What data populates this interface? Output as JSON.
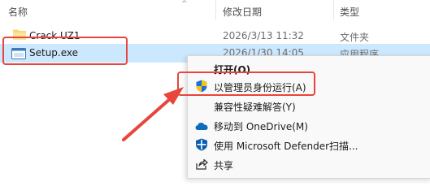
{
  "columns": {
    "name": "名称",
    "modified": "修改日期",
    "type": "类型"
  },
  "files": [
    {
      "name": "Crack UZ1",
      "modified": "2026/3/13 11:32",
      "type": "文件夹",
      "icon": "folder-icon"
    },
    {
      "name": "Setup.exe",
      "modified": "2026/1/30 14:05",
      "type": "应用程序",
      "icon": "exe-icon"
    }
  ],
  "context_menu": {
    "items": [
      {
        "label": "打开(O)",
        "icon": ""
      },
      {
        "label": "以管理员身份运行(A)",
        "icon": "uac-shield-icon"
      },
      {
        "label": "兼容性疑难解答(Y)",
        "icon": ""
      },
      {
        "label": "移动到 OneDrive(M)",
        "icon": "onedrive-icon"
      },
      {
        "label": "使用 Microsoft Defender扫描...",
        "icon": "defender-icon"
      },
      {
        "label": "共享",
        "icon": "share-icon"
      }
    ]
  },
  "colors": {
    "selection": "#cce8ff",
    "annotation": "#e8453c",
    "folder": "#f8d775",
    "uac_blue": "#1e6fd9",
    "uac_yellow": "#f3c318",
    "onedrive": "#0f6cbd",
    "defender": "#0a5db3"
  }
}
